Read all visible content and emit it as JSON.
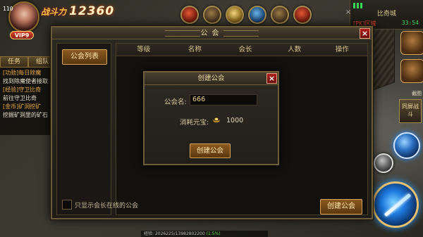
{
  "player": {
    "level": "110",
    "vip": "VIP9",
    "power_label": "战斗力",
    "power_value": "12360"
  },
  "minimap": {
    "map_name": "比奇城",
    "time": "33:54",
    "pk_status": "[PK]区域"
  },
  "quest_panel": {
    "tabs": [
      "任务",
      "组队"
    ],
    "lines": [
      {
        "text": "[功勋]每日除魔",
        "kind": "title"
      },
      {
        "text": "找到除魔使者接取",
        "kind": "desc"
      },
      {
        "text": "[经验]守卫比奇",
        "kind": "title"
      },
      {
        "text": "前往守卫比奇",
        "kind": "desc"
      },
      {
        "text": "[金币]矿洞挖矿",
        "kind": "title"
      },
      {
        "text": "挖掘矿洞里的矿石",
        "kind": "desc"
      }
    ]
  },
  "right_buttons": {
    "combat": "同屏战斗",
    "screenshot": "截图"
  },
  "bottom_bar": {
    "label": "经验:",
    "value": "2026225/13982802200",
    "percent": "(1.5%)"
  },
  "guild_window": {
    "title": "公会",
    "guild_list_button": "公会列表",
    "columns": [
      "等级",
      "名称",
      "会长",
      "人数",
      "操作"
    ],
    "online_only_label": "只显示会长在线的公会",
    "online_only_checked": false,
    "create_button": "创建公会"
  },
  "create_dialog": {
    "title": "创建公会",
    "name_label": "公会名:",
    "name_value": "666",
    "cost_label": "消耗元宝:",
    "cost_value": "1000",
    "confirm_button": "创建公会"
  },
  "colors": {
    "accent_gold": "#d6a458",
    "close_red": "#b0201a",
    "quest_title": "#e8a545"
  }
}
